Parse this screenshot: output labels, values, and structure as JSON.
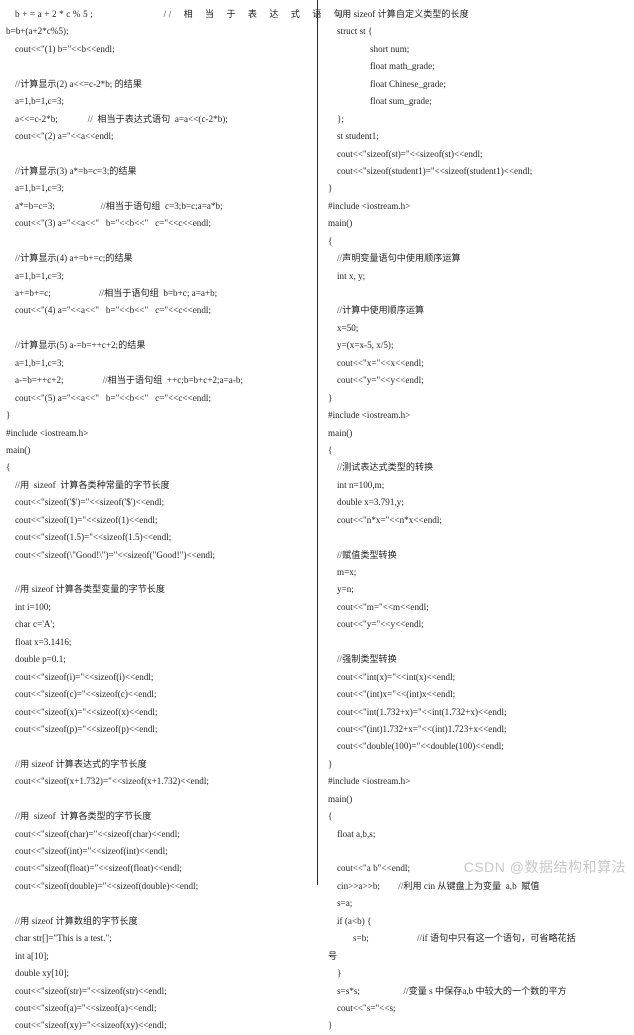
{
  "document": {
    "type": "scanned-textbook-page",
    "language": "C++",
    "columns": 2,
    "watermark": "CSDN @数据结构和算法",
    "watermark_color": "#c9c9c9"
  },
  "left_column": {
    "lines": [
      {
        "text": "b+=a+2*c%5;              //  相  当  于  表  达  式  语  句",
        "indent": 1,
        "style": "tracked"
      },
      {
        "text": "b=b+(a+2*c%5);",
        "indent": 0,
        "style": ""
      },
      {
        "text": "cout<<\"(1) b=\"<<b<<endl;",
        "indent": 1,
        "style": ""
      },
      {
        "text": "",
        "indent": 0,
        "style": ""
      },
      {
        "text": "//计算显示(2) a<<=c-2*b; 的结果",
        "indent": 1,
        "style": ""
      },
      {
        "text": "a=1,b=1,c=3;",
        "indent": 1,
        "style": ""
      },
      {
        "text": "a<<=c-2*b;             //  相当于表达式语句  a=a<<(c-2*b);",
        "indent": 1,
        "style": ""
      },
      {
        "text": "cout<<\"(2) a=\"<<a<<endl;",
        "indent": 1,
        "style": ""
      },
      {
        "text": "",
        "indent": 0,
        "style": ""
      },
      {
        "text": "//计算显示(3) a*=b=c=3;的结果",
        "indent": 1,
        "style": ""
      },
      {
        "text": "a=1,b=1,c=3;",
        "indent": 1,
        "style": ""
      },
      {
        "text": "a*=b=c=3;                    //相当于语句组  c=3;b=c;a=a*b;",
        "indent": 1,
        "style": ""
      },
      {
        "text": "cout<<\"(3) a=\"<<a<<\"   b=\"<<b<<\"   c=\"<<c<<endl;",
        "indent": 1,
        "style": ""
      },
      {
        "text": "",
        "indent": 0,
        "style": ""
      },
      {
        "text": "//计算显示(4) a+=b+=c;的结果",
        "indent": 1,
        "style": ""
      },
      {
        "text": "a=1,b=1,c=3;",
        "indent": 1,
        "style": ""
      },
      {
        "text": "a+=b+=c;                     //相当于语句组  b=b+c; a=a+b;",
        "indent": 1,
        "style": ""
      },
      {
        "text": "cout<<\"(4) a=\"<<a<<\"   b=\"<<b<<\"   c=\"<<c<<endl;",
        "indent": 1,
        "style": ""
      },
      {
        "text": "",
        "indent": 0,
        "style": ""
      },
      {
        "text": "//计算显示(5) a-=b=++c+2;的结果",
        "indent": 1,
        "style": ""
      },
      {
        "text": "a=1,b=1,c=3;",
        "indent": 1,
        "style": ""
      },
      {
        "text": "a-=b=++c+2;                 //相当于语句组  ++c;b=b+c+2;a=a-b;",
        "indent": 1,
        "style": ""
      },
      {
        "text": "cout<<\"(5) a=\"<<a<<\"   b=\"<<b<<\"   c=\"<<c<<endl;",
        "indent": 1,
        "style": ""
      },
      {
        "text": "}",
        "indent": 0,
        "style": ""
      },
      {
        "text": "#include <iostream.h>",
        "indent": 0,
        "style": ""
      },
      {
        "text": "main()",
        "indent": 0,
        "style": ""
      },
      {
        "text": "{",
        "indent": 0,
        "style": ""
      },
      {
        "text": "//用  sizeof  计算各类种常量的字节长度",
        "indent": 1,
        "style": ""
      },
      {
        "text": "cout<<\"sizeof('$')=\"<<sizeof('$')<<endl;",
        "indent": 1,
        "style": ""
      },
      {
        "text": "cout<<\"sizeof(1)=\"<<sizeof(1)<<endl;",
        "indent": 1,
        "style": ""
      },
      {
        "text": "cout<<\"sizeof(1.5)=\"<<sizeof(1.5)<<endl;",
        "indent": 1,
        "style": ""
      },
      {
        "text": "cout<<\"sizeof(\\\"Good!\\\")=\"<<sizeof(\"Good!\")<<endl;",
        "indent": 1,
        "style": ""
      },
      {
        "text": "",
        "indent": 0,
        "style": ""
      },
      {
        "text": "//用 sizeof 计算各类型变量的字节长度",
        "indent": 1,
        "style": ""
      },
      {
        "text": "int i=100;",
        "indent": 1,
        "style": ""
      },
      {
        "text": "char c='A';",
        "indent": 1,
        "style": ""
      },
      {
        "text": "float x=3.1416;",
        "indent": 1,
        "style": ""
      },
      {
        "text": "double p=0.1;",
        "indent": 1,
        "style": ""
      },
      {
        "text": "cout<<\"sizeof(i)=\"<<sizeof(i)<<endl;",
        "indent": 1,
        "style": ""
      },
      {
        "text": "cout<<\"sizeof(c)=\"<<sizeof(c)<<endl;",
        "indent": 1,
        "style": ""
      },
      {
        "text": "cout<<\"sizeof(x)=\"<<sizeof(x)<<endl;",
        "indent": 1,
        "style": ""
      },
      {
        "text": "cout<<\"sizeof(p)=\"<<sizeof(p)<<endl;",
        "indent": 1,
        "style": ""
      },
      {
        "text": "",
        "indent": 0,
        "style": ""
      },
      {
        "text": "//用 sizeof 计算表达式的字节长度",
        "indent": 1,
        "style": ""
      },
      {
        "text": "cout<<\"sizeof(x+1.732)=\"<<sizeof(x+1.732)<<endl;",
        "indent": 1,
        "style": ""
      },
      {
        "text": "",
        "indent": 0,
        "style": ""
      },
      {
        "text": "//用  sizeof  计算各类型的字节长度",
        "indent": 1,
        "style": ""
      },
      {
        "text": "cout<<\"sizeof(char)=\"<<sizeof(char)<<endl;",
        "indent": 1,
        "style": ""
      },
      {
        "text": "cout<<\"sizeof(int)=\"<<sizeof(int)<<endl;",
        "indent": 1,
        "style": ""
      },
      {
        "text": "cout<<\"sizeof(float)=\"<<sizeof(float)<<endl;",
        "indent": 1,
        "style": ""
      },
      {
        "text": "cout<<\"sizeof(double)=\"<<sizeof(double)<<endl;",
        "indent": 1,
        "style": ""
      },
      {
        "text": "",
        "indent": 0,
        "style": ""
      },
      {
        "text": "//用 sizeof 计算数组的字节长度",
        "indent": 1,
        "style": ""
      },
      {
        "text": "char str[]=\"This is a test.\";",
        "indent": 1,
        "style": ""
      },
      {
        "text": "int a[10];",
        "indent": 1,
        "style": ""
      },
      {
        "text": "double xy[10];",
        "indent": 1,
        "style": ""
      },
      {
        "text": "cout<<\"sizeof(str)=\"<<sizeof(str)<<endl;",
        "indent": 1,
        "style": ""
      },
      {
        "text": "cout<<\"sizeof(a)=\"<<sizeof(a)<<endl;",
        "indent": 1,
        "style": ""
      },
      {
        "text": "cout<<\"sizeof(xy)=\"<<sizeof(xy)<<endl;",
        "indent": 1,
        "style": ""
      }
    ]
  },
  "right_column": {
    "lines": [
      {
        "text": "//用 sizeof 计算自定义类型的长度",
        "indent": 1,
        "style": ""
      },
      {
        "text": "struct st {",
        "indent": 1,
        "style": ""
      },
      {
        "text": "short num;",
        "indent": 3,
        "style": ""
      },
      {
        "text": "float math_grade;",
        "indent": 3,
        "style": ""
      },
      {
        "text": "float Chinese_grade;",
        "indent": 3,
        "style": ""
      },
      {
        "text": "float sum_grade;",
        "indent": 3,
        "style": ""
      },
      {
        "text": "};",
        "indent": 1,
        "style": ""
      },
      {
        "text": "st student1;",
        "indent": 1,
        "style": ""
      },
      {
        "text": "cout<<\"sizeof(st)=\"<<sizeof(st)<<endl;",
        "indent": 1,
        "style": ""
      },
      {
        "text": "cout<<\"sizeof(student1)=\"<<sizeof(student1)<<endl;",
        "indent": 1,
        "style": ""
      },
      {
        "text": "}",
        "indent": 0,
        "style": ""
      },
      {
        "text": "#include <iostream.h>",
        "indent": 0,
        "style": ""
      },
      {
        "text": "main()",
        "indent": 0,
        "style": ""
      },
      {
        "text": "{",
        "indent": 0,
        "style": ""
      },
      {
        "text": "//声明变量语句中使用顺序运算",
        "indent": 1,
        "style": ""
      },
      {
        "text": "int x, y;",
        "indent": 1,
        "style": ""
      },
      {
        "text": "",
        "indent": 0,
        "style": ""
      },
      {
        "text": "//计算中使用顺序运算",
        "indent": 1,
        "style": ""
      },
      {
        "text": "x=50;",
        "indent": 1,
        "style": ""
      },
      {
        "text": "y=(x=x-5, x/5);",
        "indent": 1,
        "style": ""
      },
      {
        "text": "cout<<\"x=\"<<x<<endl;",
        "indent": 1,
        "style": ""
      },
      {
        "text": "cout<<\"y=\"<<y<<endl;",
        "indent": 1,
        "style": ""
      },
      {
        "text": "}",
        "indent": 0,
        "style": ""
      },
      {
        "text": "#include <iostream.h>",
        "indent": 0,
        "style": ""
      },
      {
        "text": "main()",
        "indent": 0,
        "style": ""
      },
      {
        "text": "{",
        "indent": 0,
        "style": ""
      },
      {
        "text": "//测试表达式类型的转换",
        "indent": 1,
        "style": ""
      },
      {
        "text": "int n=100,m;",
        "indent": 1,
        "style": ""
      },
      {
        "text": "double x=3.791,y;",
        "indent": 1,
        "style": ""
      },
      {
        "text": "cout<<\"n*x=\"<<n*x<<endl;",
        "indent": 1,
        "style": ""
      },
      {
        "text": "",
        "indent": 0,
        "style": ""
      },
      {
        "text": "//赋值类型转换",
        "indent": 1,
        "style": ""
      },
      {
        "text": "m=x;",
        "indent": 1,
        "style": ""
      },
      {
        "text": "y=n;",
        "indent": 1,
        "style": ""
      },
      {
        "text": "cout<<\"m=\"<<m<<endl;",
        "indent": 1,
        "style": ""
      },
      {
        "text": "cout<<\"y=\"<<y<<endl;",
        "indent": 1,
        "style": ""
      },
      {
        "text": "",
        "indent": 0,
        "style": ""
      },
      {
        "text": "//强制类型转换",
        "indent": 1,
        "style": ""
      },
      {
        "text": "cout<<\"int(x)=\"<<int(x)<<endl;",
        "indent": 1,
        "style": ""
      },
      {
        "text": "cout<<\"(int)x=\"<<(int)x<<endl;",
        "indent": 1,
        "style": ""
      },
      {
        "text": "cout<<\"int(1.732+x)=\"<<int(1.732+x)<<endl;",
        "indent": 1,
        "style": ""
      },
      {
        "text": "cout<<\"(int)1.732+x=\"<<(int)1.723+x<<endl;",
        "indent": 1,
        "style": ""
      },
      {
        "text": "cout<<\"double(100)=\"<<double(100)<<endl;",
        "indent": 1,
        "style": ""
      },
      {
        "text": "}",
        "indent": 0,
        "style": ""
      },
      {
        "text": "#include <iostream.h>",
        "indent": 0,
        "style": ""
      },
      {
        "text": "main()",
        "indent": 0,
        "style": ""
      },
      {
        "text": "{",
        "indent": 0,
        "style": ""
      },
      {
        "text": "float a,b,s;",
        "indent": 1,
        "style": ""
      },
      {
        "text": "",
        "indent": 0,
        "style": ""
      },
      {
        "text": "cout<<\"a b\"<<endl;",
        "indent": 1,
        "style": ""
      },
      {
        "text": "cin>>a>>b;        //利用 cin 从键盘上为变量  a,b  赋值",
        "indent": 1,
        "style": ""
      },
      {
        "text": "s=a;",
        "indent": 1,
        "style": ""
      },
      {
        "text": "if (a<b) {",
        "indent": 1,
        "style": ""
      },
      {
        "text": "s=b;                     //if 语句中只有这一个语句，可省略花括",
        "indent": 2,
        "style": ""
      },
      {
        "text": "号",
        "indent": 0,
        "style": ""
      },
      {
        "text": "}",
        "indent": 1,
        "style": ""
      },
      {
        "text": "s=s*s;                   //变量 s 中保存a,b 中较大的一个数的平方",
        "indent": 1,
        "style": ""
      },
      {
        "text": "cout<<\"s=\"<<s;",
        "indent": 1,
        "style": ""
      },
      {
        "text": "}",
        "indent": 0,
        "style": ""
      }
    ]
  }
}
